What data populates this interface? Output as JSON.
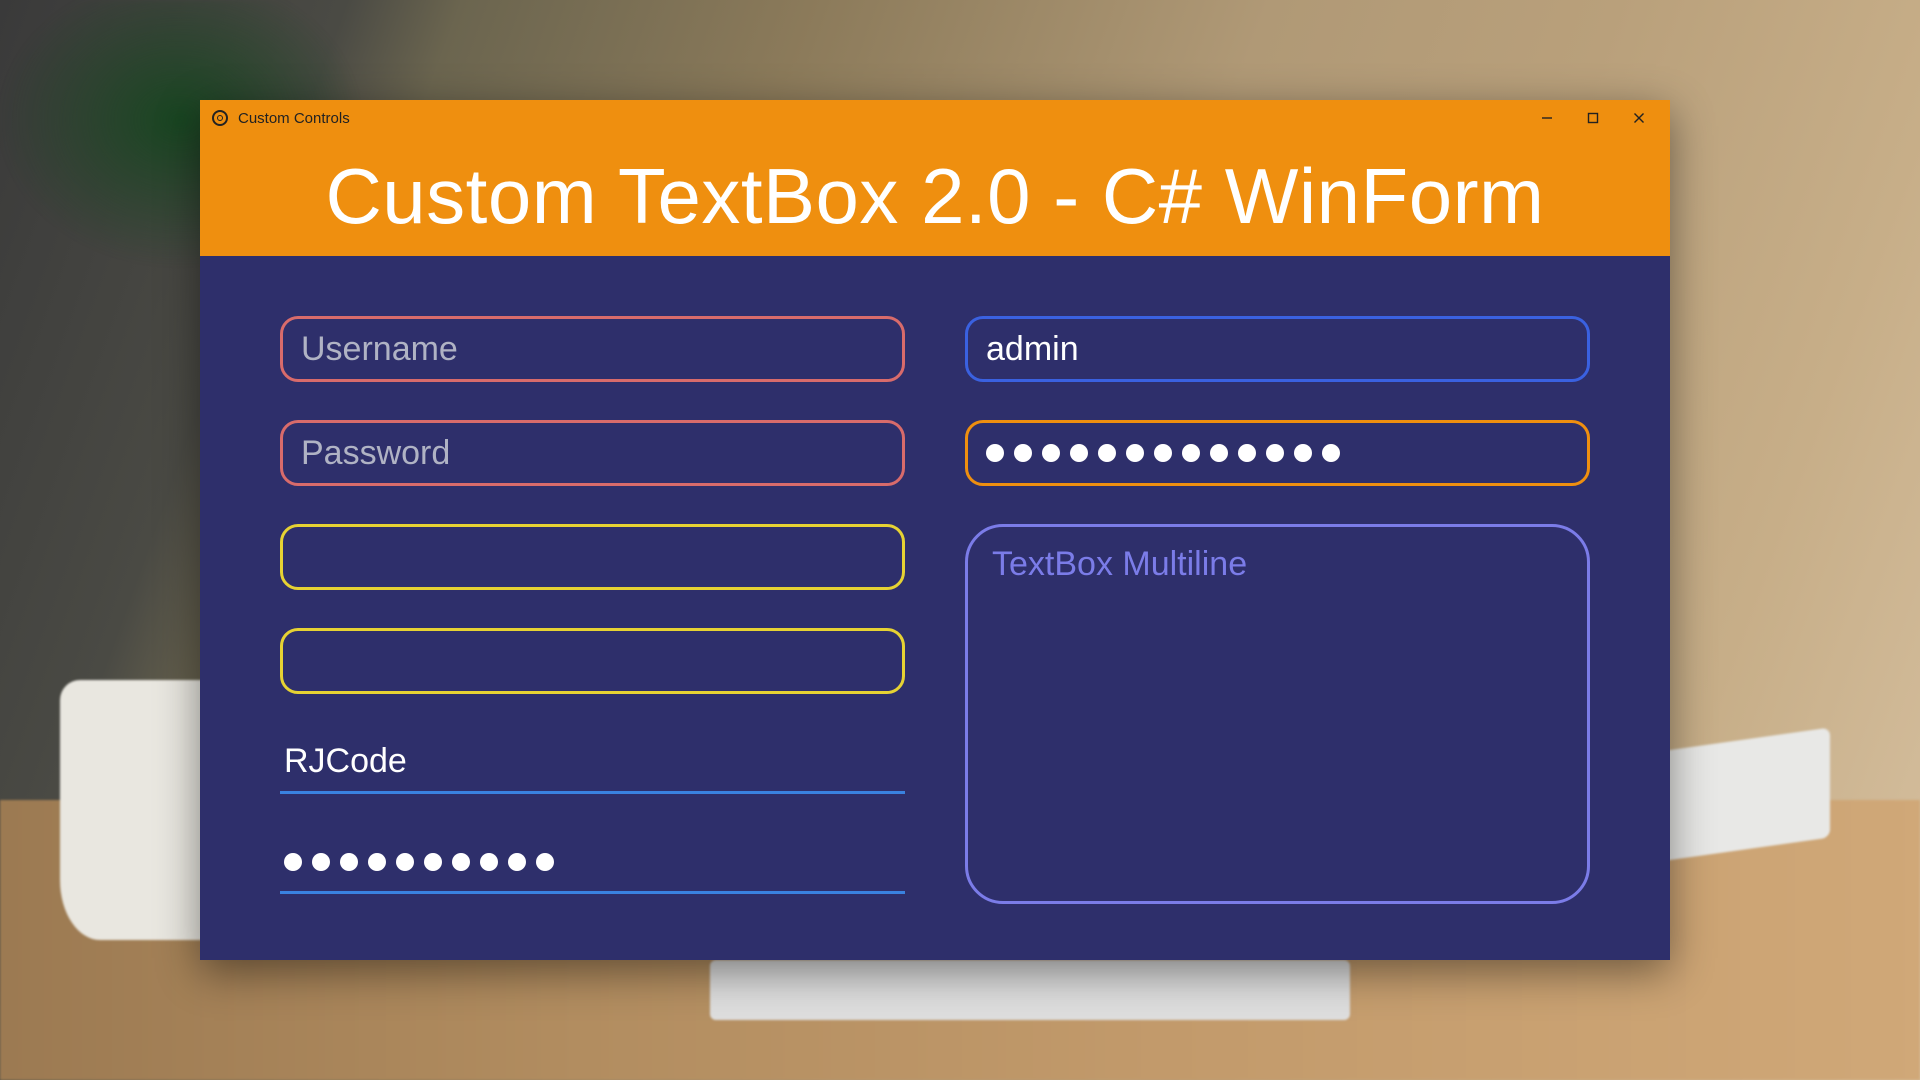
{
  "window": {
    "title": "Custom Controls"
  },
  "header": {
    "title": "Custom TextBox 2.0 - C# WinForm"
  },
  "left": {
    "username": {
      "placeholder": "Username",
      "value": ""
    },
    "password": {
      "placeholder": "Password",
      "value": ""
    },
    "blank1": {
      "placeholder": "",
      "value": ""
    },
    "blank2": {
      "placeholder": "",
      "value": ""
    },
    "rjcode": {
      "value": "RJCode"
    },
    "underline_pw": {
      "dot_count": 10
    }
  },
  "right": {
    "admin": {
      "value": "admin"
    },
    "password": {
      "dot_count": 13
    },
    "multiline": {
      "placeholder": "TextBox Multiline",
      "value": ""
    }
  },
  "colors": {
    "accent_orange": "#ef8f0f",
    "panel_bg": "#2e2f6b",
    "coral": "#d86b6b",
    "yellow": "#e6d233",
    "blue": "#3a61e0",
    "violet": "#7b7ce8",
    "underline_blue": "#3a82e0"
  }
}
